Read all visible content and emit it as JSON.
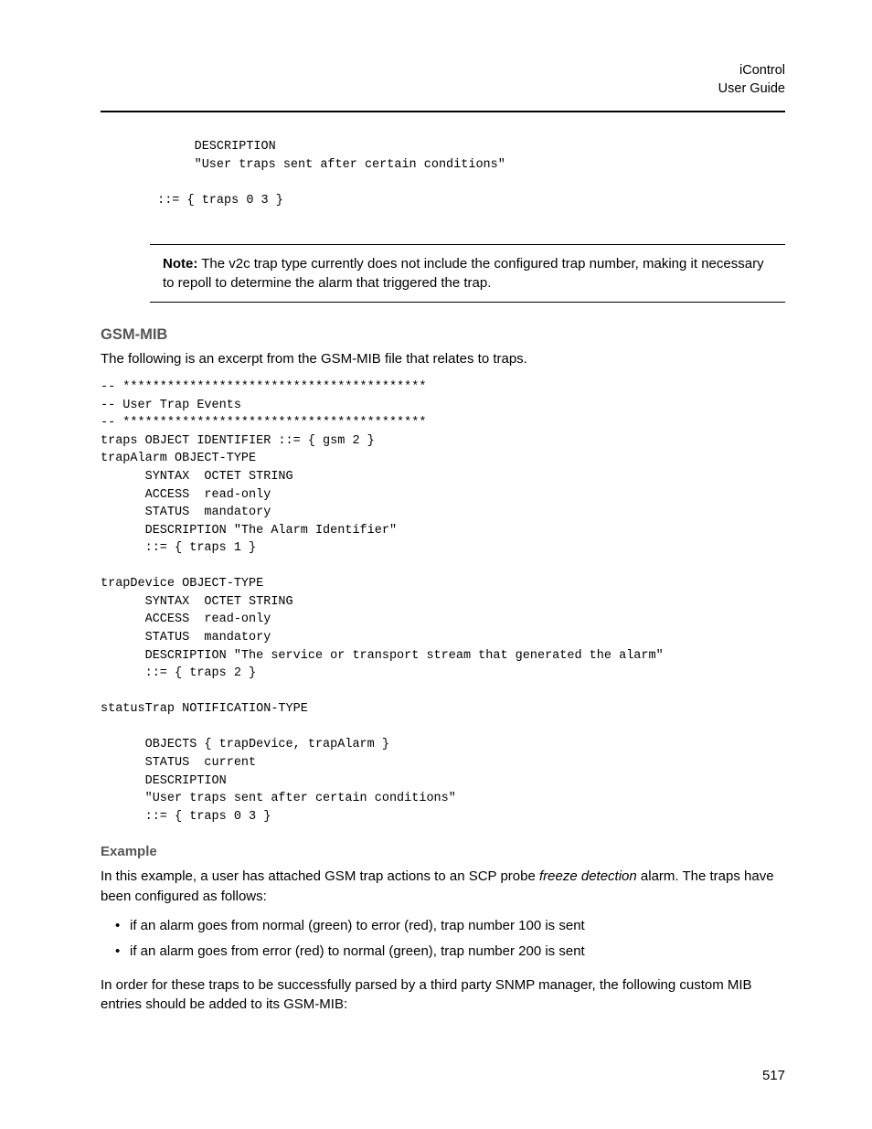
{
  "header": {
    "product": "iControl",
    "subtitle": "User Guide"
  },
  "code1": "      DESCRIPTION\n      \"User traps sent after certain conditions\"\n\n ::= { traps 0 3 }",
  "note": {
    "label": "Note:",
    "text": "The v2c trap type currently does not include the configured trap number, making it necessary to repoll to determine the alarm that triggered the trap."
  },
  "section1": {
    "heading": "GSM-MIB",
    "intro": "The following is an excerpt from the GSM-MIB file that relates to traps."
  },
  "code2": "-- *****************************************\n-- User Trap Events\n-- *****************************************\ntraps OBJECT IDENTIFIER ::= { gsm 2 }\ntrapAlarm OBJECT-TYPE\n      SYNTAX  OCTET STRING\n      ACCESS  read-only\n      STATUS  mandatory\n      DESCRIPTION \"The Alarm Identifier\"\n      ::= { traps 1 }\n\ntrapDevice OBJECT-TYPE\n      SYNTAX  OCTET STRING\n      ACCESS  read-only\n      STATUS  mandatory\n      DESCRIPTION \"The service or transport stream that generated the alarm\"\n      ::= { traps 2 }\n\nstatusTrap NOTIFICATION-TYPE\n\n      OBJECTS { trapDevice, trapAlarm }\n      STATUS  current\n      DESCRIPTION\n      \"User traps sent after certain conditions\"\n      ::= { traps 0 3 }",
  "example": {
    "heading": "Example",
    "intro_pre": "In this example, a user has attached GSM trap actions to an SCP probe ",
    "intro_italic": "freeze detection",
    "intro_post": " alarm. The traps have been configured as follows:",
    "bullets": [
      "if an alarm goes from normal (green) to error (red), trap number 100 is sent",
      "if an alarm goes from error (red) to normal (green), trap number 200 is sent"
    ],
    "outro": "In order for these traps to be successfully parsed by a third party SNMP manager, the following custom MIB entries should be added to its GSM-MIB:"
  },
  "page_number": "517"
}
